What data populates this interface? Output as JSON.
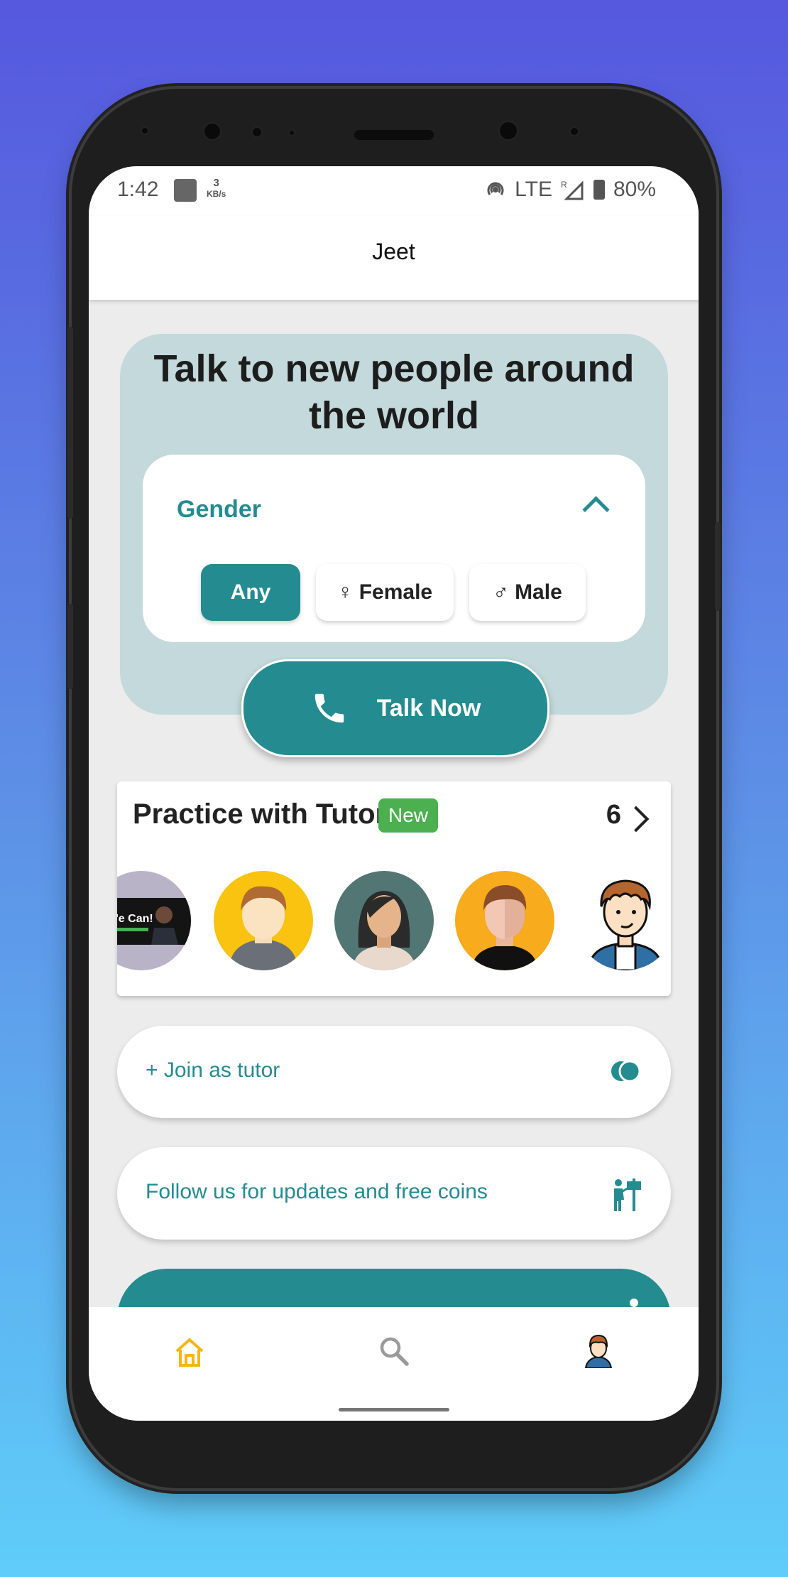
{
  "status_bar": {
    "time": "1:42",
    "data_rate_value": "3",
    "data_rate_unit": "KB/s",
    "network": "LTE",
    "roaming": "R",
    "battery": "80%"
  },
  "app_bar": {
    "title": "Jeet"
  },
  "hero": {
    "title": "Talk to new people around the world",
    "gender_filter": {
      "label": "Gender",
      "options": [
        "Any",
        "♀ Female",
        "♂ Male"
      ],
      "selected": "Any"
    },
    "talk_button_label": "Talk Now"
  },
  "tutors": {
    "title": "Practice with Tutor",
    "badge": "New",
    "count": "6",
    "avatars": [
      "video-thumbnail",
      "boy-hoodie",
      "woman-dark-hair",
      "man-orange",
      "cartoon-curly-hair"
    ]
  },
  "join_tutor": {
    "label": "+ Join as tutor",
    "icon": "coins-icon"
  },
  "follow": {
    "label": "Follow us for updates and free coins",
    "icon": "signpost-person-icon"
  },
  "bottom_nav": {
    "items": [
      "home-icon",
      "search-icon",
      "profile-avatar"
    ],
    "active": "home-icon"
  },
  "colors": {
    "accent": "#248b91",
    "hero_bg": "#c3d9db",
    "badge": "#4caf50",
    "nav_active": "#f9b515"
  }
}
